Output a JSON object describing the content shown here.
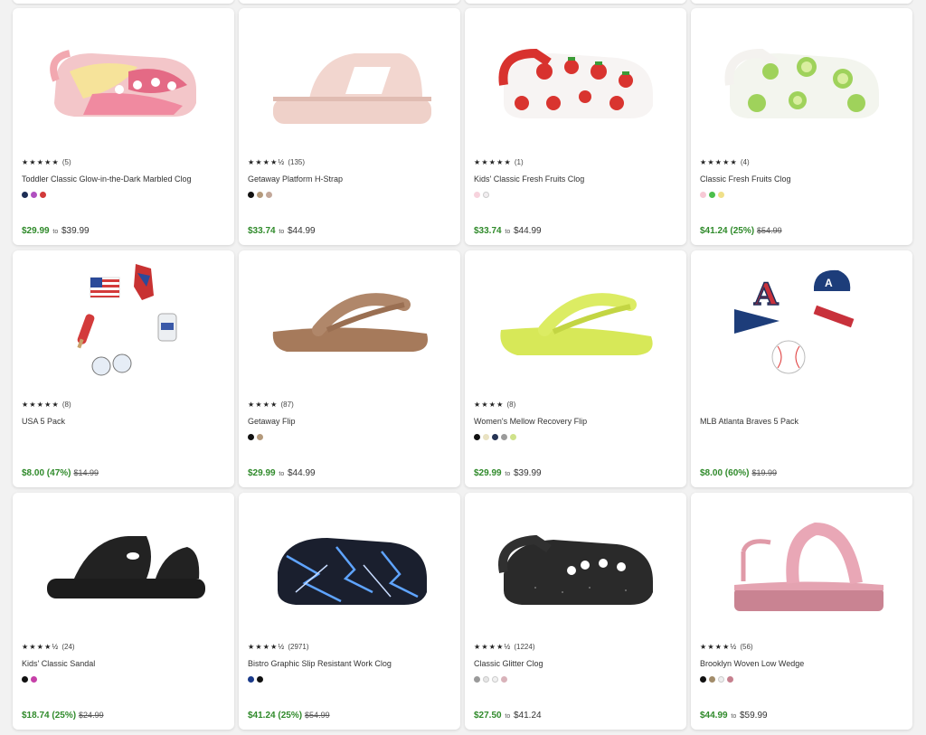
{
  "products": [
    {
      "name": "Toddler Classic Glow-in-the-Dark Marbled Clog",
      "stars": "★★★★★",
      "count": "(5)",
      "swatches": [
        "#1d2e55",
        "#b050c0",
        "#d23a3a"
      ],
      "price": {
        "sale": "$29.99",
        "to": "to",
        "high": "$39.99",
        "orig": ""
      },
      "icon": "marbled-clog-icon"
    },
    {
      "name": "Getaway Platform H-Strap",
      "stars": "★★★★½",
      "count": "(135)",
      "swatches": [
        "#111111",
        "#b49a7c",
        "#c3a89a"
      ],
      "price": {
        "sale": "$33.74",
        "to": "to",
        "high": "$44.99",
        "orig": ""
      },
      "icon": "platform-slide-icon"
    },
    {
      "name": "Kids' Classic Fresh Fruits Clog",
      "stars": "★★★★★",
      "count": "(1)",
      "swatches": [
        "#f7d3dd",
        "#f2eef0"
      ],
      "price": {
        "sale": "$33.74",
        "to": "to",
        "high": "$44.99",
        "orig": ""
      },
      "icon": "fruit-clog-icon"
    },
    {
      "name": "Classic Fresh Fruits Clog",
      "stars": "★★★★★",
      "count": "(4)",
      "swatches": [
        "#f7c9d5",
        "#4bbf4b",
        "#f0e08a"
      ],
      "price": {
        "sale": "$41.24 (25%)",
        "to": "",
        "high": "",
        "orig": "$54.99"
      },
      "icon": "lime-clog-icon"
    },
    {
      "name": "USA 5 Pack",
      "stars": "★★★★★",
      "count": "(8)",
      "swatches": [],
      "price": {
        "sale": "$8.00 (47%)",
        "to": "",
        "high": "",
        "orig": "$14.99"
      },
      "icon": "usa-charms-icon"
    },
    {
      "name": "Getaway Flip",
      "stars": "★★★★",
      "count": "(87)",
      "swatches": [
        "#111111",
        "#b49a7c"
      ],
      "price": {
        "sale": "$29.99",
        "to": "to",
        "high": "$44.99",
        "orig": ""
      },
      "icon": "brown-flip-icon"
    },
    {
      "name": "Women's Mellow Recovery Flip",
      "stars": "★★★★",
      "count": "(8)",
      "swatches": [
        "#111111",
        "#e9e2c2",
        "#263454",
        "#9b9b9b",
        "#cfe28a"
      ],
      "price": {
        "sale": "$29.99",
        "to": "to",
        "high": "$39.99",
        "orig": ""
      },
      "icon": "lime-flip-icon"
    },
    {
      "name": "MLB Atlanta Braves 5 Pack",
      "stars": "",
      "count": "",
      "swatches": [],
      "price": {
        "sale": "$8.00 (60%)",
        "to": "",
        "high": "",
        "orig": "$19.99"
      },
      "icon": "braves-charms-icon"
    },
    {
      "name": "Kids' Classic Sandal",
      "stars": "★★★★½",
      "count": "(24)",
      "swatches": [
        "#111111",
        "#c640a8"
      ],
      "price": {
        "sale": "$18.74 (25%)",
        "to": "",
        "high": "",
        "orig": "$24.99"
      },
      "icon": "black-sandal-icon"
    },
    {
      "name": "Bistro Graphic Slip Resistant Work Clog",
      "stars": "★★★★½",
      "count": "(2971)",
      "swatches": [
        "#1a3a8a",
        "#111111"
      ],
      "price": {
        "sale": "$41.24 (25%)",
        "to": "",
        "high": "",
        "orig": "$54.99"
      },
      "icon": "lightning-clog-icon"
    },
    {
      "name": "Classic Glitter Clog",
      "stars": "★★★★½",
      "count": "(1224)",
      "swatches": [
        "#9a9a9a",
        "#e6e6e6",
        "#f1f1f1",
        "#d9b3ba"
      ],
      "price": {
        "sale": "$27.50",
        "to": "to",
        "high": "$41.24",
        "orig": ""
      },
      "icon": "glitter-clog-icon"
    },
    {
      "name": "Brooklyn Woven Low Wedge",
      "stars": "★★★★½",
      "count": "(56)",
      "swatches": [
        "#111111",
        "#a28c6a",
        "#eeeeee",
        "#c6808e"
      ],
      "price": {
        "sale": "$44.99",
        "to": "to",
        "high": "$59.99",
        "orig": ""
      },
      "icon": "pink-wedge-icon"
    }
  ]
}
